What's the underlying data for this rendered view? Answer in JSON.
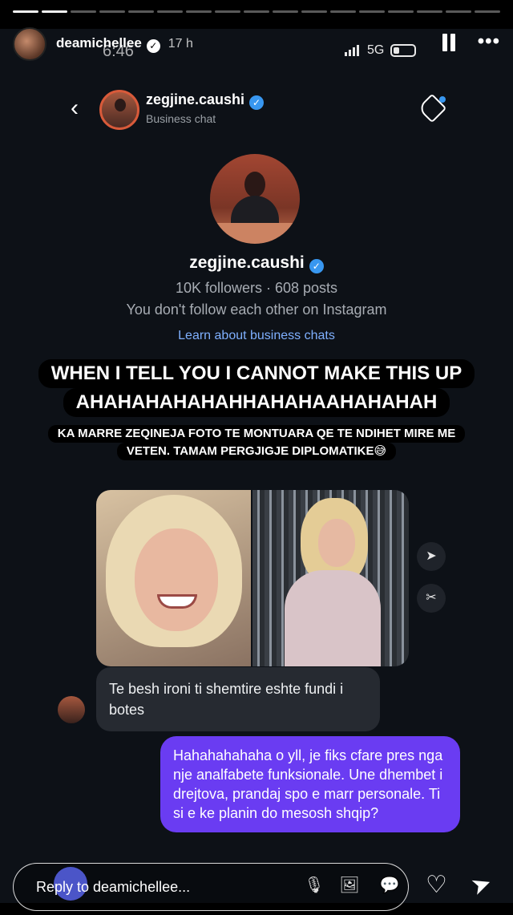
{
  "story": {
    "username": "deamichellee",
    "time_ago": "17 h",
    "progress_segments": 17,
    "progress_done": 2,
    "reply_placeholder": "Reply to deamichellee..."
  },
  "screenshot_status": {
    "time": "6:46",
    "network": "5G"
  },
  "chat": {
    "name": "zegjine.caushi",
    "subtitle": "Business chat"
  },
  "profile": {
    "name": "zegjine.caushi",
    "stats": "10K followers · 608 posts",
    "follow_status": "You don't follow each other on Instagram",
    "link": "Learn about business chats"
  },
  "captions": {
    "line1": "WHEN I TELL YOU I CANNOT MAKE THIS UP",
    "line2": "AHAHAHAHAHAHHAHAHAAHAHAHAH",
    "line3": "KA MARRE ZEQINEJA FOTO TE MONTUARA QE TE NDIHET MIRE ME",
    "line4": "VETEN. TAMAM PERGJIGJE DIPLOMATIKE😅"
  },
  "messages": {
    "incoming": "Te besh ironi ti shemtire eshte fundi i botes",
    "outgoing": "Hahahahahaha o yll, je fiks cfare pres nga nje analfabete funksionale. Une dhembet i drejtova, prandaj spo e marr personale. Ti si e ke planin do mesosh shqip?"
  },
  "colors": {
    "outgoing_bubble": "#6a3cf2",
    "incoming_bubble": "#262a31",
    "link": "#7fb0ff",
    "verified": "#3897f0"
  }
}
